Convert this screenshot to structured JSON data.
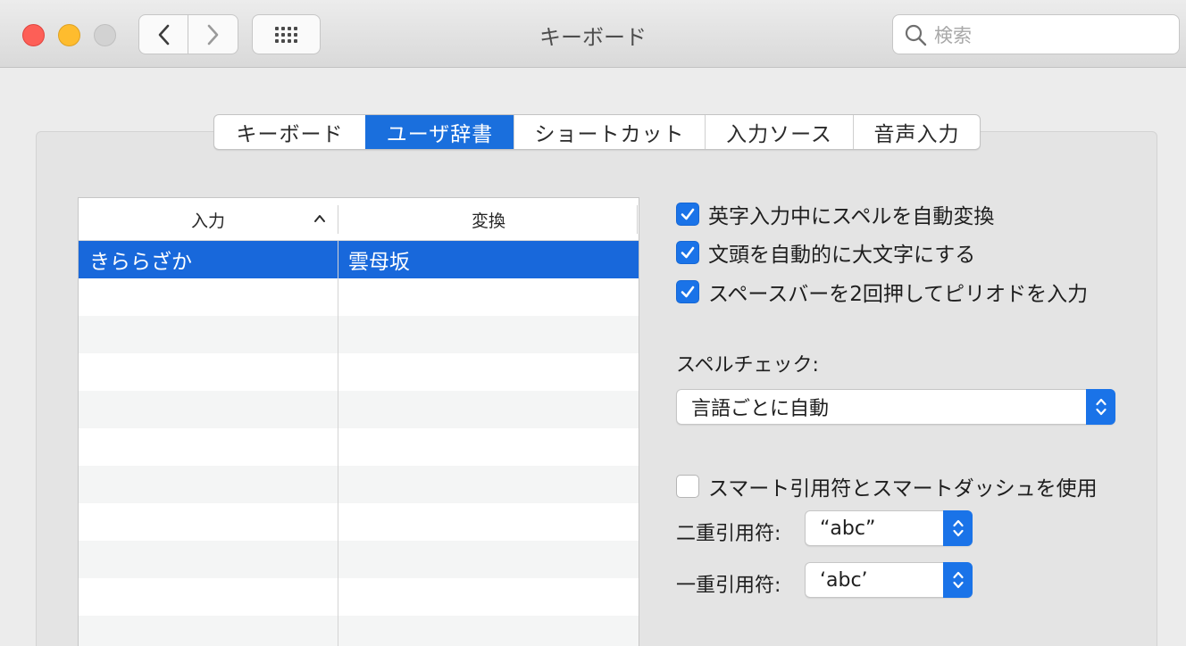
{
  "window": {
    "title": "キーボード"
  },
  "search": {
    "placeholder": "検索"
  },
  "tabs": [
    {
      "label": "キーボード",
      "active": false
    },
    {
      "label": "ユーザ辞書",
      "active": true
    },
    {
      "label": "ショートカット",
      "active": false
    },
    {
      "label": "入力ソース",
      "active": false
    },
    {
      "label": "音声入力",
      "active": false
    }
  ],
  "table": {
    "columns": [
      "入力",
      "変換"
    ],
    "rows": [
      {
        "input": "きららざか",
        "conversion": "雲母坂",
        "selected": true
      }
    ]
  },
  "options": {
    "checkboxes": [
      {
        "label": "英字入力中にスペルを自動変換",
        "checked": true
      },
      {
        "label": "文頭を自動的に大文字にする",
        "checked": true
      },
      {
        "label": "スペースバーを2回押してピリオドを入力",
        "checked": true
      }
    ],
    "spellcheck_label": "スペルチェック:",
    "spellcheck_value": "言語ごとに自動",
    "smart_quotes": {
      "label": "スマート引用符とスマートダッシュを使用",
      "checked": false
    },
    "double_quote_label": "二重引用符:",
    "double_quote_value": "“abc”",
    "single_quote_label": "一重引用符:",
    "single_quote_value": "‘abc’"
  },
  "colors": {
    "accent": "#1a73e8",
    "selection": "#1868db"
  }
}
